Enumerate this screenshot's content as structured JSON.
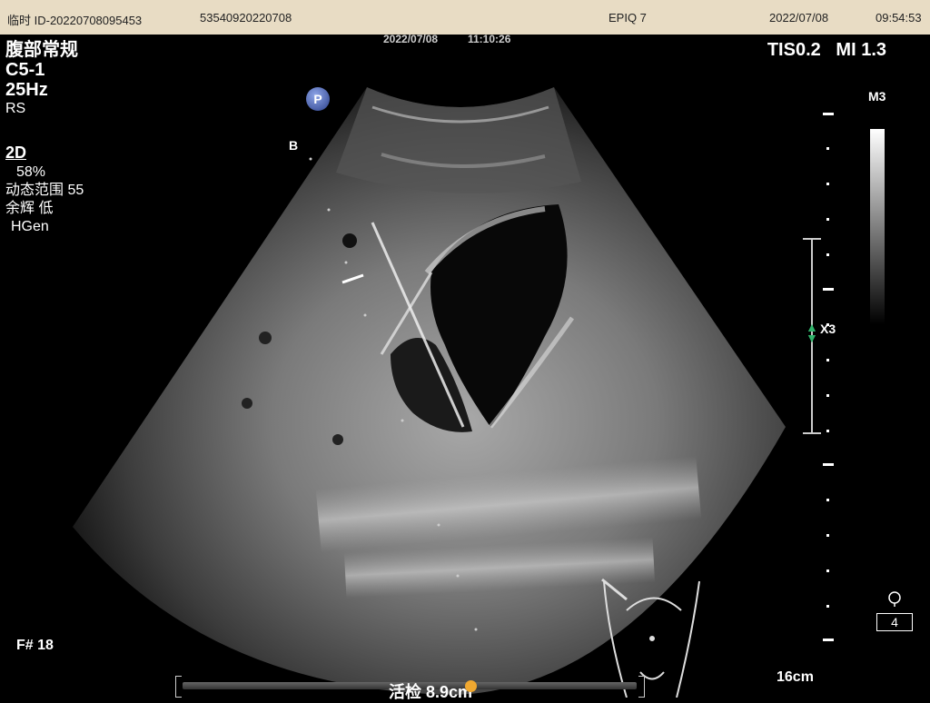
{
  "header": {
    "patient_id": "临时 ID-20220708095453",
    "accession": "53540920220708",
    "system": "EPIQ 7",
    "date": "2022/07/08",
    "time": "09:54:53"
  },
  "image_timestamp": {
    "date": "2022/07/08",
    "time": "11:10:26"
  },
  "exam": {
    "preset": "腹部常规",
    "transducer": "C5-1",
    "frame_rate": "25Hz",
    "resolution": "RS"
  },
  "mode": {
    "label": "2D",
    "gain": "58%",
    "dynamic_range": "动态范围 55",
    "persistence": "余辉 低",
    "frequency": "HGen"
  },
  "safety": {
    "tis": "TIS0.2",
    "mi": "MI 1.3"
  },
  "map": {
    "label": "M3"
  },
  "markers": {
    "b_label": "B",
    "p_label": "P",
    "focus_label": "X3"
  },
  "frame_number": "F# 18",
  "depth": "16cm",
  "page_number": "4",
  "biopsy_label": "活检 8.9cm",
  "colors": {
    "header_bg": "#e8dcc4",
    "focus_marker": "#2fb36a",
    "biopsy_knob": "#f0a830"
  },
  "icons": [
    "p-marker-icon",
    "rotate-icon",
    "body-marker-icon"
  ]
}
